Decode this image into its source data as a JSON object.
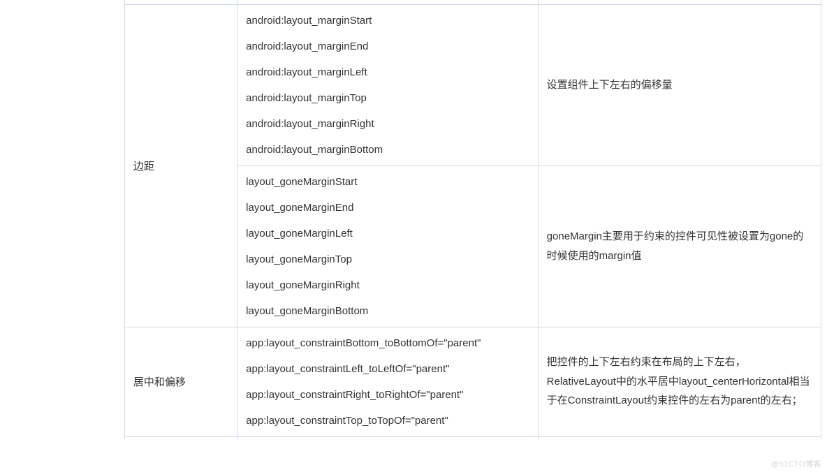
{
  "watermark": "@51CTO博客",
  "rows": [
    {
      "category": "边距",
      "sections": [
        {
          "attributes": [
            "android:layout_marginStart",
            "android:layout_marginEnd",
            "android:layout_marginLeft",
            "android:layout_marginTop",
            "android:layout_marginRight",
            "android:layout_marginBottom"
          ],
          "description": "设置组件上下左右的偏移量"
        },
        {
          "attributes": [
            "layout_goneMarginStart",
            "layout_goneMarginEnd",
            "layout_goneMarginLeft",
            "layout_goneMarginTop",
            "layout_goneMarginRight",
            "layout_goneMarginBottom"
          ],
          "description": "goneMargin主要用于约束的控件可见性被设置为gone的时候使用的margin值"
        }
      ]
    },
    {
      "category": "居中和偏移",
      "sections": [
        {
          "attributes": [
            "app:layout_constraintBottom_toBottomOf=\"parent\"",
            "app:layout_constraintLeft_toLeftOf=\"parent\"",
            "app:layout_constraintRight_toRightOf=\"parent\"",
            "app:layout_constraintTop_toTopOf=\"parent\""
          ],
          "description": "把控件的上下左右约束在布局的上下左右，RelativeLayout中的水平居中layout_centerHorizontal相当于在ConstraintLayout约束控件的左右为parent的左右；"
        }
      ]
    }
  ]
}
